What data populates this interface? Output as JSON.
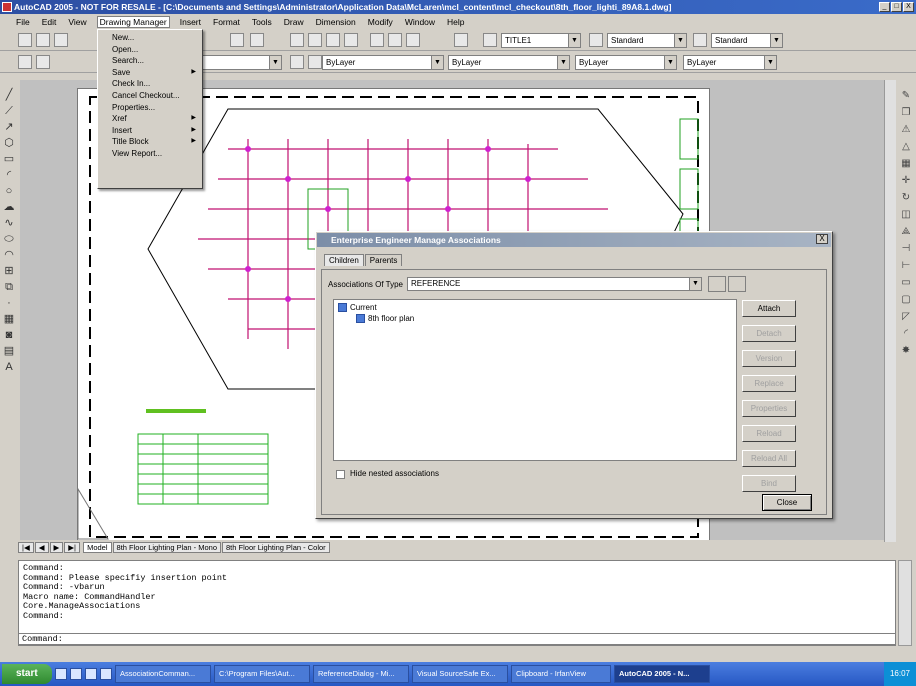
{
  "window": {
    "title": "AutoCAD 2005 - NOT FOR RESALE - [C:\\Documents and Settings\\Administrator\\Application Data\\McLaren\\mcl_content\\mcl_checkout\\8th_floor_lighti_89A8.1.dwg]",
    "controls": [
      "_",
      "□",
      "X"
    ]
  },
  "menubar": [
    "File",
    "Edit",
    "View",
    "Drawing Manager",
    "Insert",
    "Format",
    "Tools",
    "Draw",
    "Dimension",
    "Modify",
    "Window",
    "Help"
  ],
  "toolbar": {
    "textstyle": "TITLE1",
    "dimstyle": "Standard",
    "plotstyle": "Standard",
    "layer_color": "ByLayer",
    "linetype": "ByLayer",
    "lineweight": "ByLayer",
    "plot": "ByLayer"
  },
  "drawing_manager_menu": [
    {
      "label": "New...",
      "sub": false
    },
    {
      "label": "Open...",
      "sub": false
    },
    {
      "label": "Search...",
      "sub": false
    },
    {
      "label": "Save",
      "sub": true
    },
    {
      "label": "Check In...",
      "sub": false
    },
    {
      "label": "Cancel Checkout...",
      "sub": false
    },
    {
      "label": "Properties...",
      "sub": false
    },
    {
      "label": "Xref",
      "sub": true
    },
    {
      "label": "Insert",
      "sub": true
    },
    {
      "label": "Title Block",
      "sub": true
    },
    {
      "label": "View Report...",
      "sub": false
    }
  ],
  "dialog": {
    "title": "Enterprise Engineer Manage Associations",
    "close": "X",
    "tabs": [
      "Children",
      "Parents"
    ],
    "assoc_type_label": "Associations Of Type",
    "assoc_type_value": "REFERENCE",
    "tree": {
      "root": "Current",
      "child": "8th floor plan"
    },
    "buttons": [
      {
        "label": "Attach",
        "enabled": true
      },
      {
        "label": "Detach",
        "enabled": false
      },
      {
        "label": "Version",
        "enabled": false
      },
      {
        "label": "Replace",
        "enabled": false
      },
      {
        "label": "Properties",
        "enabled": false
      },
      {
        "label": "Reload",
        "enabled": false
      },
      {
        "label": "Reload All",
        "enabled": false
      },
      {
        "label": "Bind",
        "enabled": false
      }
    ],
    "hide_nested": "Hide nested associations",
    "close_button": "Close"
  },
  "layout_tabs": [
    "Model",
    "8th Floor Lighting Plan - Mono",
    "8th Floor Lighting Plan - Color"
  ],
  "command_history": [
    "Command:",
    "Command: Please specifiy insertion point",
    "Command: -vbarun",
    "Macro name: CommandHandler",
    "Core.ManageAssociations",
    "Command:"
  ],
  "command_prompt": "Command:",
  "taskbar": {
    "start": "start",
    "tasks": [
      "AssociationComman...",
      "C:\\Program Files\\Aut...",
      "ReferenceDialog - Mi...",
      "Visual SourceSafe Ex...",
      "Clipboard - IrfanView",
      "AutoCAD 2005 - N..."
    ],
    "active_task": "AutoCAD 2005 - N...",
    "clock": "16:07"
  }
}
